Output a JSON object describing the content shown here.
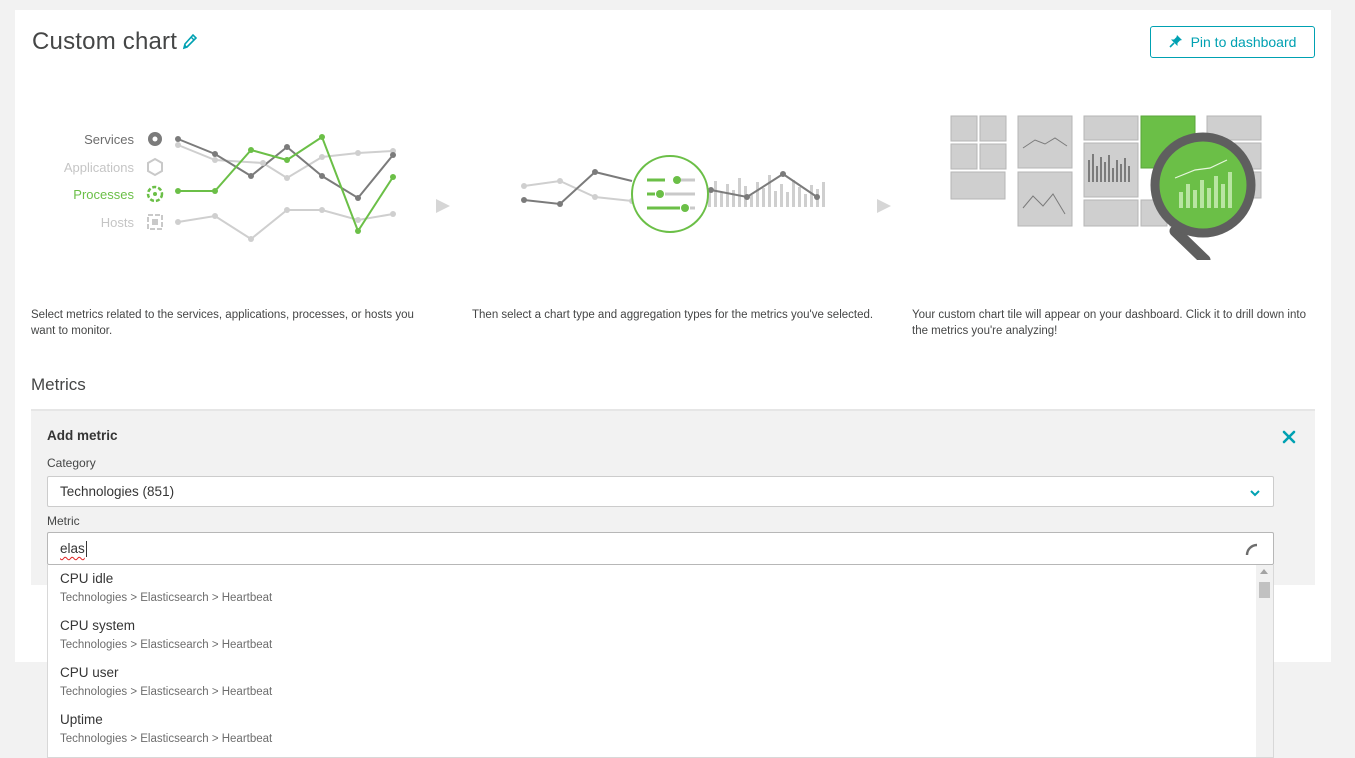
{
  "page": {
    "title": "Custom chart",
    "pin_button_label": "Pin to dashboard"
  },
  "illustration": {
    "legend": [
      "Services",
      "Applications",
      "Processes",
      "Hosts"
    ],
    "captions": [
      "Select metrics related to the services, applications, processes, or hosts you want to monitor.",
      "Then select a chart type and aggregation types for the metrics you've selected.",
      "Your custom chart tile will appear on your dashboard. Click it to drill down into the metrics you're analyzing!"
    ]
  },
  "metrics": {
    "section_title": "Metrics",
    "panel_title": "Add metric",
    "category_label": "Category",
    "category_value": "Technologies (851)",
    "metric_label": "Metric",
    "metric_value": "elas",
    "results": [
      {
        "name": "CPU idle",
        "path": "Technologies > Elasticsearch > Heartbeat"
      },
      {
        "name": "CPU system",
        "path": "Technologies > Elasticsearch > Heartbeat"
      },
      {
        "name": "CPU user",
        "path": "Technologies > Elasticsearch > Heartbeat"
      },
      {
        "name": "Uptime",
        "path": "Technologies > Elasticsearch > Heartbeat"
      }
    ]
  },
  "colors": {
    "accent": "#00a1b2",
    "green": "#6bbf47",
    "gray_dark": "#7b7b7b",
    "gray_light": "#c9c9c9"
  },
  "icons": [
    "pencil-icon",
    "pin-icon",
    "close-icon",
    "chevron-down-icon",
    "spinner-icon",
    "gear-icon",
    "hexagon-icon",
    "process-icon",
    "host-icon",
    "magnifier-icon"
  ]
}
